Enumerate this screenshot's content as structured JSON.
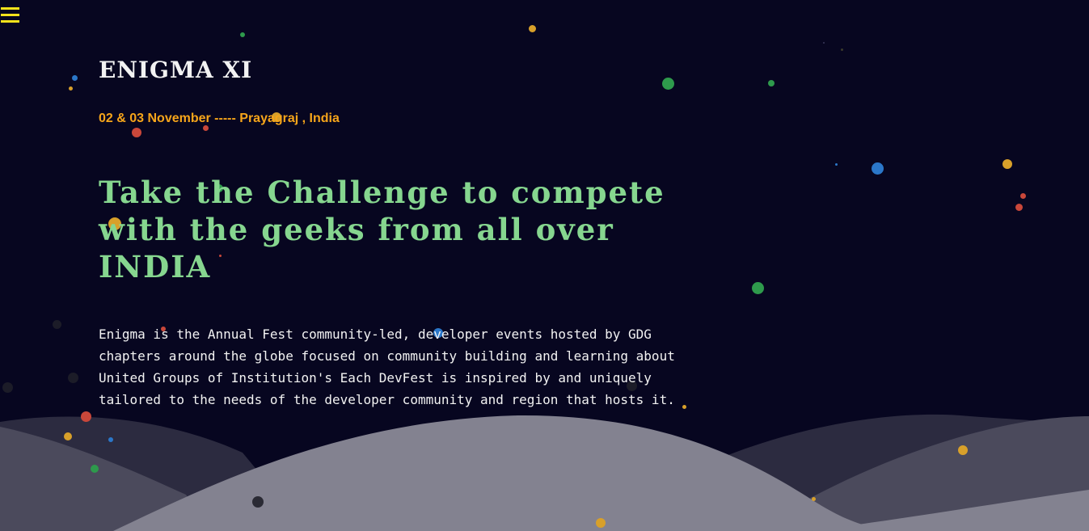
{
  "header": {
    "menu_icon": "hamburger-menu-icon"
  },
  "hero": {
    "title": "ENIGMA XI",
    "date_location": "02 & 03 November ----- Prayagraj , India",
    "headline": "Take the Challenge to compete with the geeks from all over INDIA",
    "description": "Enigma is the Annual Fest community-led, developer events hosted by GDG chapters around the globe focused on community building and learning about United Groups of Institution's Each DevFest is inspired by and uniquely tailored to the needs of the developer community and region that hosts it."
  },
  "colors": {
    "background": "#070620",
    "accent_yellow": "#f5e21b",
    "date_orange": "#f6a51a",
    "headline_green": "#86d68f",
    "text_white": "#f2f2f2",
    "hill_light": "#838290",
    "hill_mid": "#4b4a5c",
    "hill_dark": "#2c2b40"
  }
}
